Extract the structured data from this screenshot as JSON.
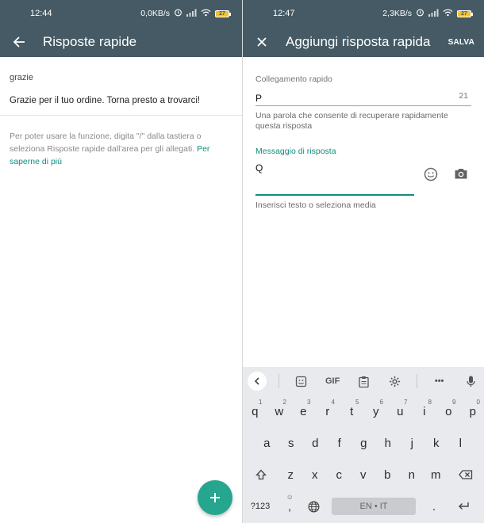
{
  "left": {
    "status": {
      "time": "12:44",
      "speed": "0,0KB/s",
      "battery": "27"
    },
    "title": "Risposte rapide",
    "item": {
      "shortcut": "grazie",
      "message": "Grazie per il tuo ordine. Torna presto a trovarci!"
    },
    "hint": {
      "text": "Per poter usare la funzione, digita \"/\" dalla tastiera o seleziona Risposte rapide dall'area per gli allegati.",
      "link": "Per saperne di più"
    },
    "fab_label": "+"
  },
  "right": {
    "status": {
      "time": "12:47",
      "speed": "2,3KB/s",
      "battery": "27"
    },
    "title": "Aggiungi risposta rapida",
    "save": "SALVA",
    "shortcut_label": "Collegamento rapido",
    "shortcut_value": "P",
    "shortcut_counter": "21",
    "shortcut_helper": "Una parola che consente di recuperare rapidamente questa risposta",
    "message_label": "Messaggio di risposta",
    "message_value": "Q",
    "message_helper": "Inserisci testo o seleziona media"
  },
  "keyboard": {
    "gif": "GIF",
    "more": "•••",
    "row1": [
      {
        "k": "q",
        "s": "1"
      },
      {
        "k": "w",
        "s": "2"
      },
      {
        "k": "e",
        "s": "3"
      },
      {
        "k": "r",
        "s": "4"
      },
      {
        "k": "t",
        "s": "5"
      },
      {
        "k": "y",
        "s": "6"
      },
      {
        "k": "u",
        "s": "7"
      },
      {
        "k": "i",
        "s": "8"
      },
      {
        "k": "o",
        "s": "9"
      },
      {
        "k": "p",
        "s": "0"
      }
    ],
    "row2": [
      "a",
      "s",
      "d",
      "f",
      "g",
      "h",
      "j",
      "k",
      "l"
    ],
    "row3": [
      "z",
      "x",
      "c",
      "v",
      "b",
      "n",
      "m"
    ],
    "symbols": "?123",
    "comma": ",",
    "period": ".",
    "space": "EN • IT"
  }
}
